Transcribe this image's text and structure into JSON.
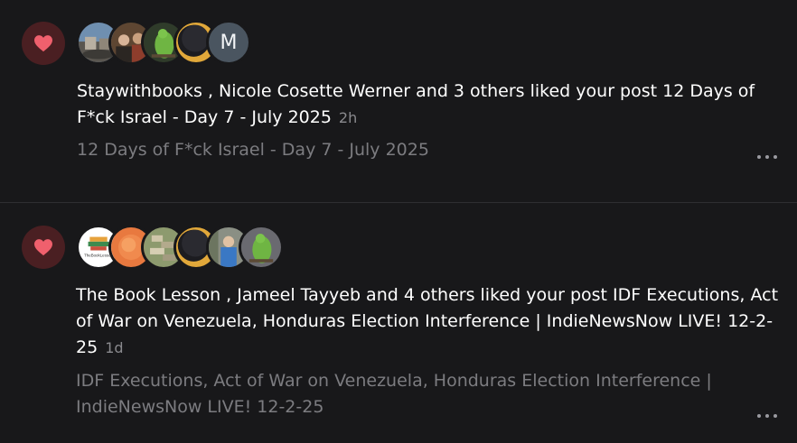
{
  "notifications": [
    {
      "heart_icon": "heart-icon",
      "text": "Staywithbooks , Nicole Cosette Werner and 3 others liked your post 12 Days of F*ck Israel - Day 7 - July 2025",
      "time": "2h",
      "post_title": "12 Days of F*ck Israel - Day 7 - July 2025",
      "avatar_letter": "M"
    },
    {
      "heart_icon": "heart-icon",
      "text": "The Book Lesson , Jameel Tayyeb and 4 others liked your post IDF Executions, Act of War on Venezuela, Honduras Election Interference | IndieNewsNow LIVE! 12-2-25",
      "time": "1d",
      "post_title": "IDF Executions, Act of War on Venezuela, Honduras Election Interference | IndieNewsNow LIVE! 12-2-25",
      "avatar_logo_text": "TheBookLesson"
    }
  ],
  "colors": {
    "background": "#18181a",
    "heart_bg": "#4a1f22",
    "heart": "#f0606d",
    "secondary_text": "#7c7c80"
  }
}
